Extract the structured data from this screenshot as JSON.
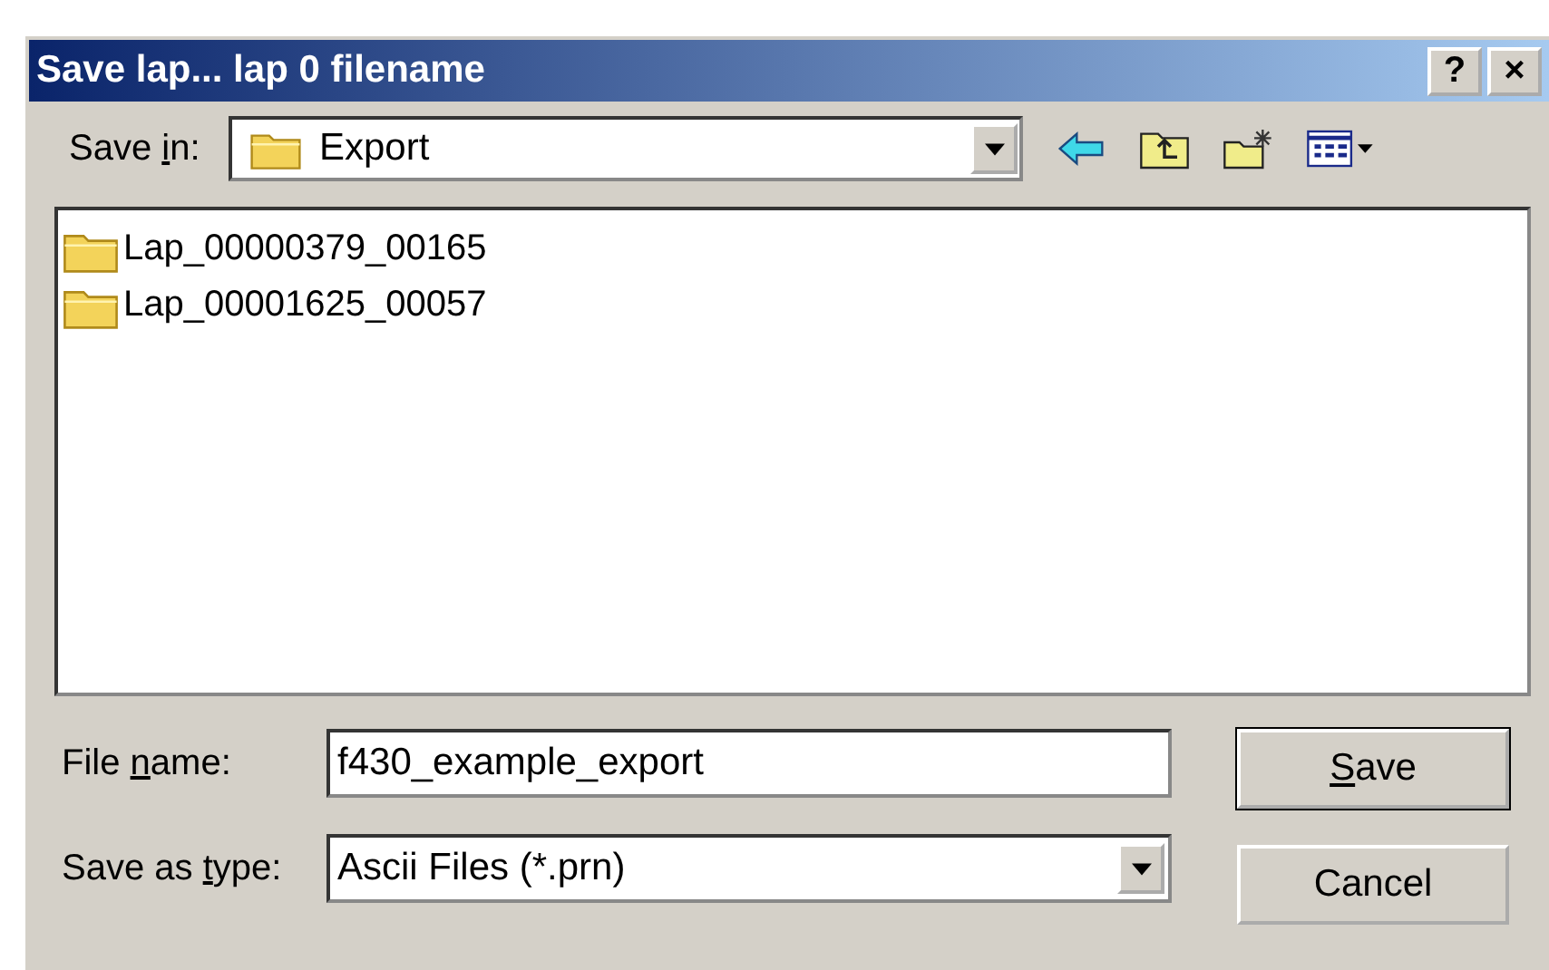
{
  "window": {
    "title": "Save lap... lap 0 filename",
    "buttons": [
      "?",
      "×"
    ]
  },
  "save_in": {
    "label": {
      "before": "Save ",
      "key": "i",
      "after": "n:"
    },
    "value": "Export"
  },
  "files": [
    {
      "name": "Lap_00000379_00165"
    },
    {
      "name": "Lap_00001625_00057"
    }
  ],
  "file_name": {
    "label": {
      "before": "File ",
      "key": "n",
      "after": "ame:"
    },
    "value": "f430_example_export"
  },
  "save_as_type": {
    "label": {
      "before": "Save as ",
      "key": "t",
      "after": "ype:"
    },
    "value": "Ascii Files (*.prn)"
  },
  "buttons": [
    {
      "label": {
        "key": "S",
        "after": "ave"
      },
      "kind": "default"
    },
    {
      "label": {
        "before": "Cancel"
      },
      "kind": "normal"
    }
  ]
}
